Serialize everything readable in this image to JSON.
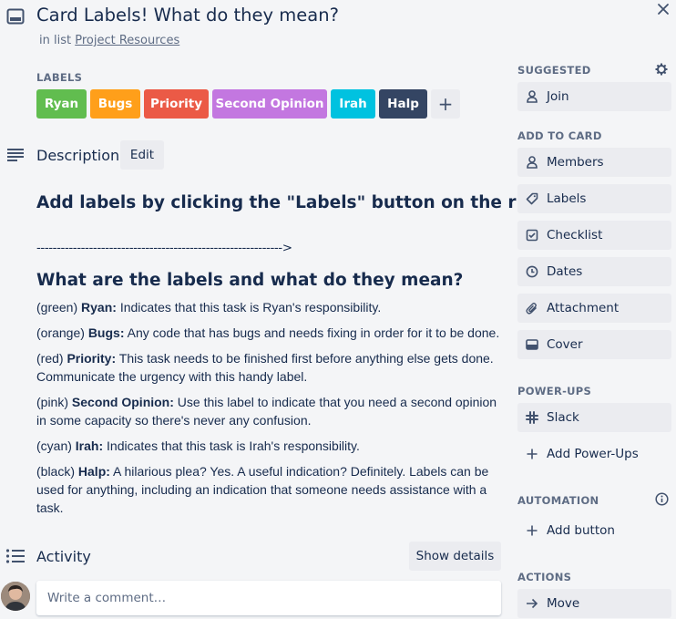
{
  "card": {
    "title": "Card Labels! What do they mean?",
    "in_list_prefix": "in list",
    "list_name": "Project Resources"
  },
  "labels": {
    "heading": "LABELS",
    "items": [
      {
        "text": "Ryan",
        "color": "#61bd4f"
      },
      {
        "text": "Bugs",
        "color": "#ff9f1a"
      },
      {
        "text": "Priority",
        "color": "#eb5a46"
      },
      {
        "text": "Second Opinion",
        "color": "#c377e0"
      },
      {
        "text": "Irah",
        "color": "#00c2e0"
      },
      {
        "text": "Halp",
        "color": "#344563"
      }
    ],
    "add": "+"
  },
  "description": {
    "heading": "Description",
    "edit": "Edit",
    "h1": "Add labels by clicking the \"Labels\" button on the right",
    "dashes": "------------------------------------------------------------->",
    "h2": "What are the labels and what do they mean?",
    "entries": [
      {
        "prefix": "(green) ",
        "name": "Ryan:",
        "text": " Indicates that this task is Ryan's responsibility."
      },
      {
        "prefix": "(orange) ",
        "name": "Bugs:",
        "text": " Any code that has bugs and needs fixing in order for it to be done."
      },
      {
        "prefix": "(red) ",
        "name": "Priority:",
        "text": " This task needs to be finished first before anything else gets done. Communicate the urgency with this handy label."
      },
      {
        "prefix": "(pink) ",
        "name": "Second Opinion:",
        "text": " Use this label to indicate that you need a second opinion in some capacity so there's never any confusion."
      },
      {
        "prefix": "(cyan) ",
        "name": "Irah:",
        "text": " Indicates that this task is Irah's responsibility."
      },
      {
        "prefix": "(black) ",
        "name": "Halp:",
        "text": " A hilarious plea? Yes. A useful indication? Definitely. Labels can be used for anything, including an indication that someone needs assistance with a task."
      }
    ]
  },
  "activity": {
    "heading": "Activity",
    "show_details": "Show details",
    "comment_placeholder": "Write a comment…"
  },
  "sidebar": {
    "suggested": "SUGGESTED",
    "join": "Join",
    "add_to_card": "ADD TO CARD",
    "add_items": [
      "Members",
      "Labels",
      "Checklist",
      "Dates",
      "Attachment",
      "Cover"
    ],
    "power_ups": "POWER-UPS",
    "slack": "Slack",
    "add_power_ups": "Add Power-Ups",
    "automation": "AUTOMATION",
    "add_button": "Add button",
    "actions": "ACTIONS",
    "move": "Move"
  }
}
